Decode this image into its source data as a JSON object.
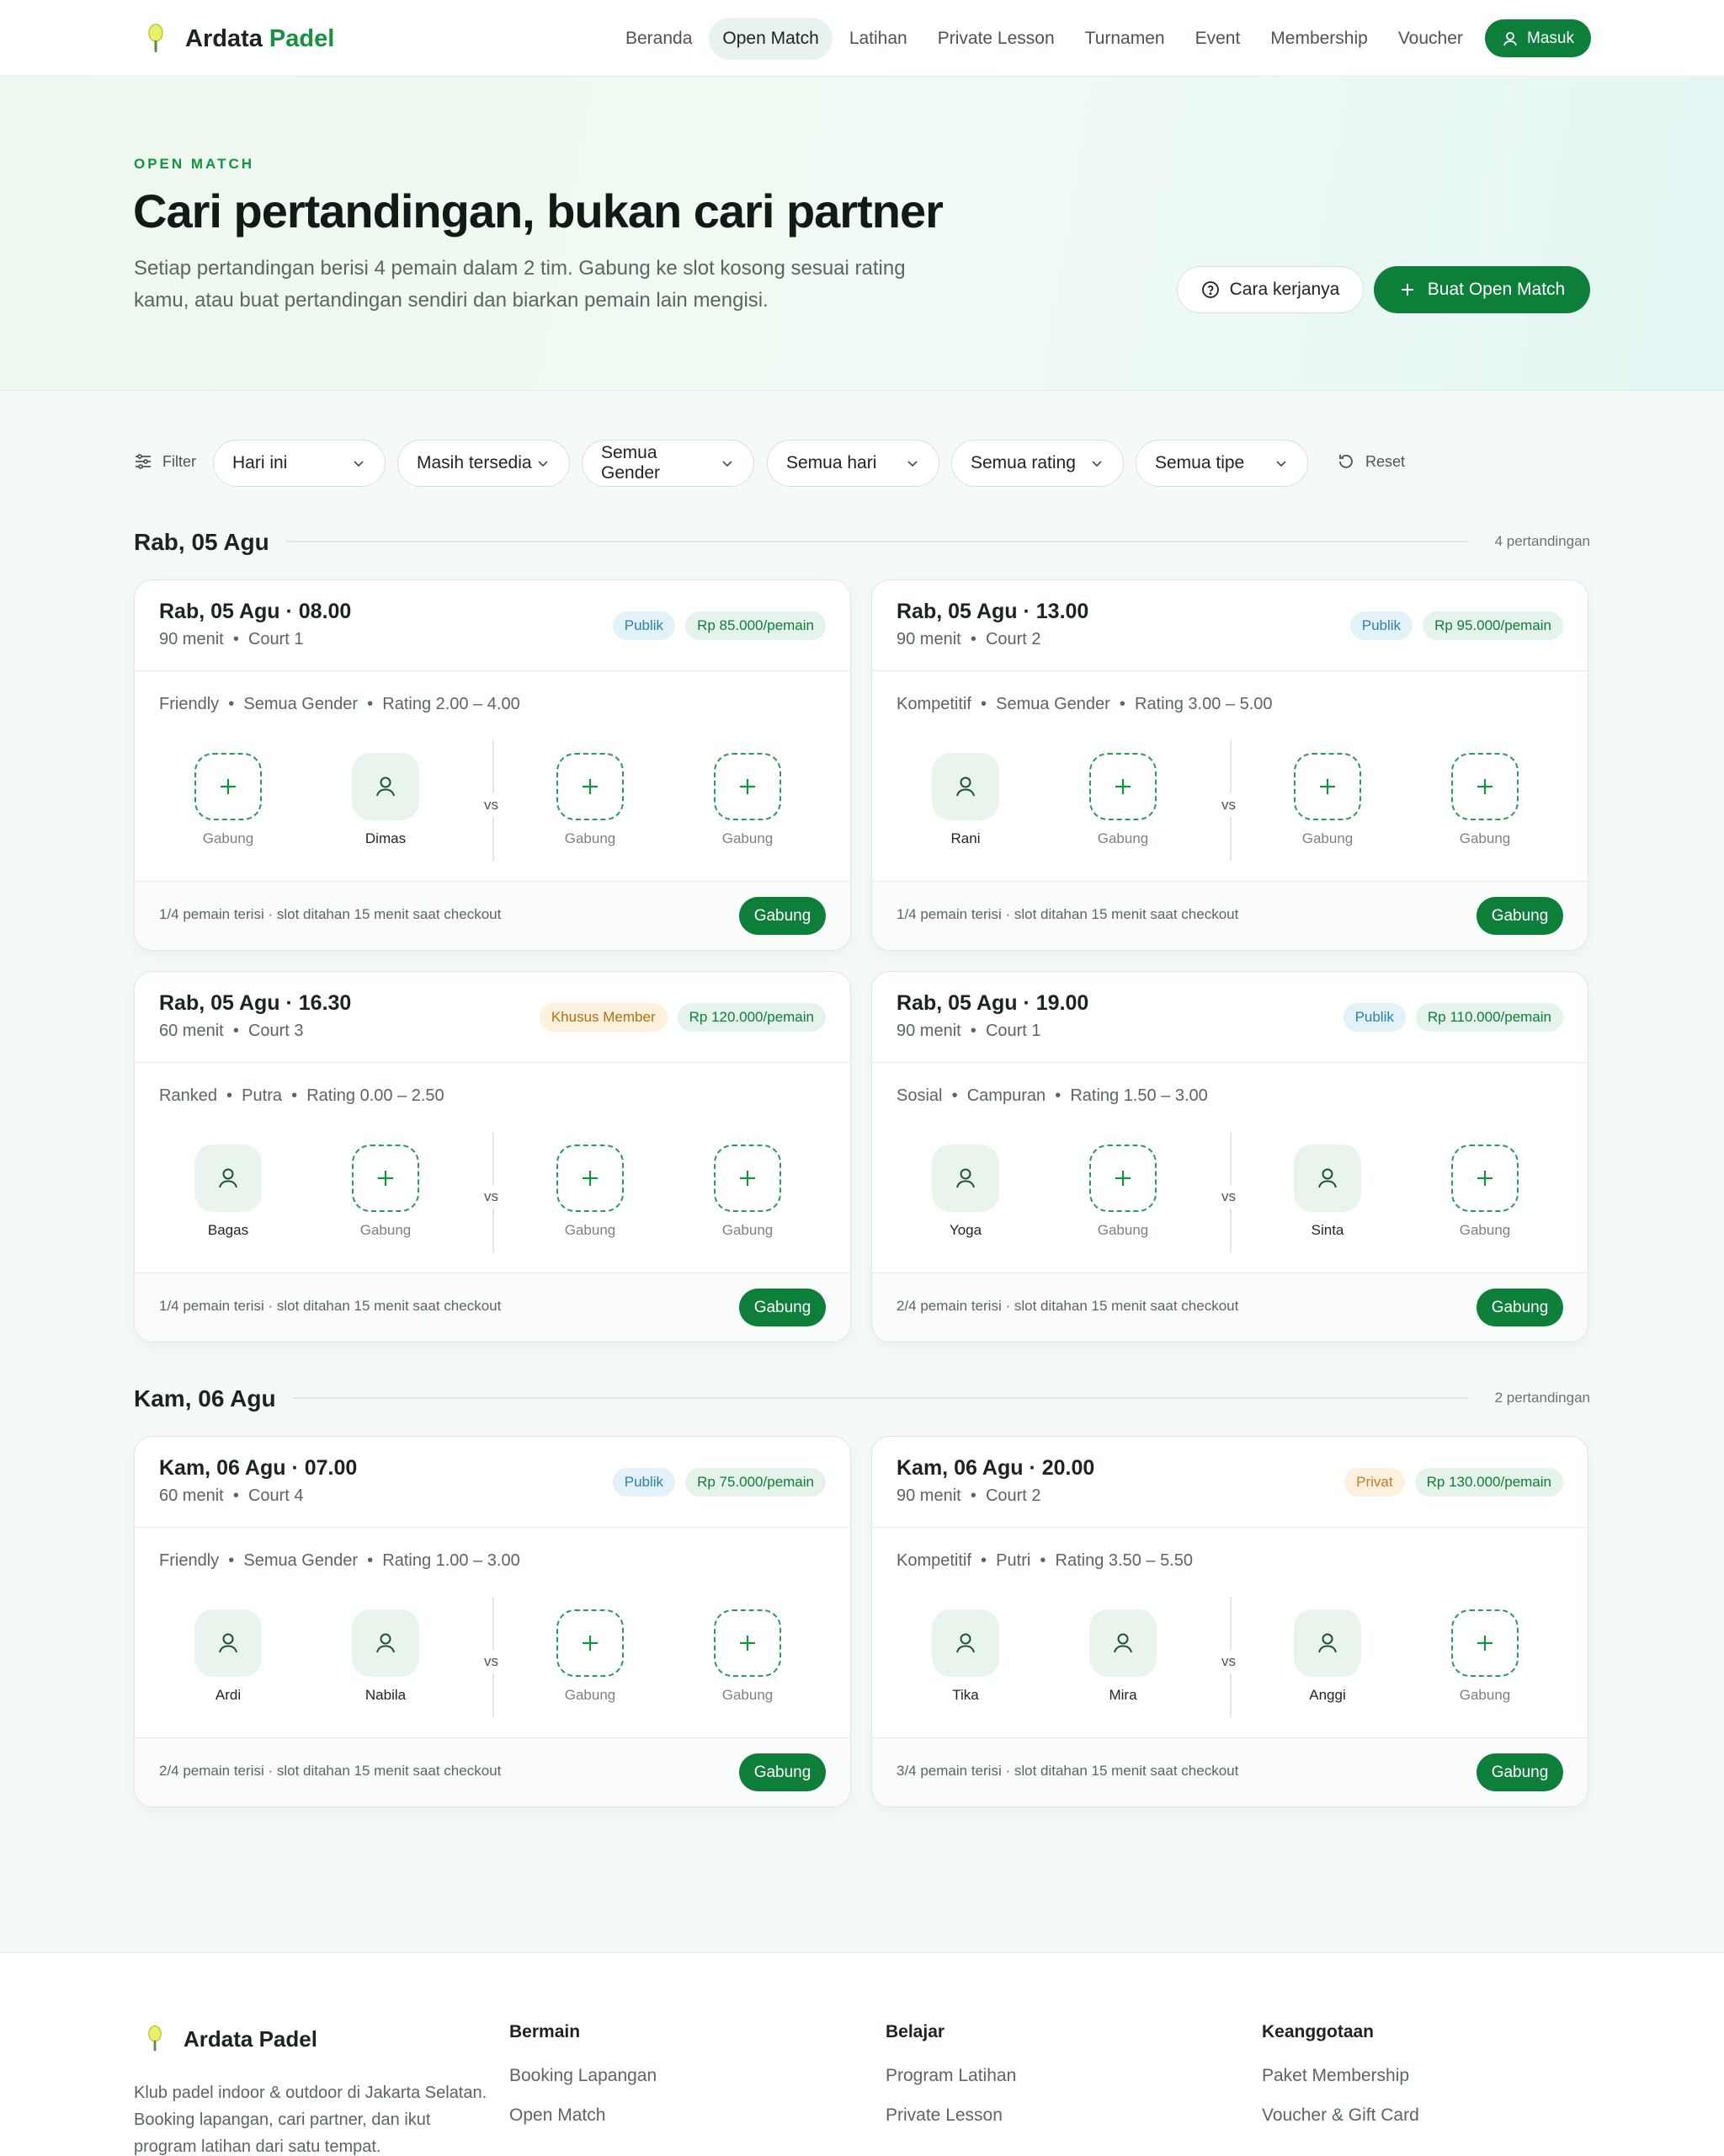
{
  "nav": {
    "brand_main": "Ardata",
    "brand_accent": "Padel",
    "links": [
      "Beranda",
      "Open Match",
      "Latihan",
      "Private Lesson",
      "Turnamen",
      "Event",
      "Membership",
      "Voucher"
    ],
    "login": "Masuk"
  },
  "hero": {
    "eyebrow": "OPEN MATCH",
    "title": "Cari pertandingan, bukan cari partner",
    "subtitle": "Setiap pertandingan berisi 4 pemain dalam 2 tim. Gabung ke slot kosong sesuai rating kamu, atau buat pertandingan sendiri dan biarkan pemain lain mengisi.",
    "how_button": "Cara kerjanya",
    "create_button": "Buat Open Match"
  },
  "filters": {
    "label": "Filter",
    "selects": [
      "Hari ini",
      "Masih tersedia",
      "Semua Gender",
      "Semua hari",
      "Semua rating",
      "Semua tipe"
    ],
    "reset": "Reset"
  },
  "days": [
    {
      "title": "Rab, 05 Agu",
      "count": "4 pertandingan",
      "matches": [
        {
          "time": "Rab, 05 Agu · 08.00",
          "duration": "90 menit",
          "court": "Court 1",
          "access": "Publik",
          "access_type": "publik",
          "price": "Rp 85.000/pemain",
          "type": "Friendly",
          "gender": "Semua Gender",
          "rating": "Rating 2.00 – 4.00",
          "slots": [
            {
              "name": "Gabung",
              "filled": false
            },
            {
              "name": "Dimas",
              "filled": true
            },
            {
              "name": "Gabung",
              "filled": false
            },
            {
              "name": "Gabung",
              "filled": false
            }
          ],
          "note": "1/4 pemain terisi · slot ditahan 15 menit saat checkout",
          "join": "Gabung"
        },
        {
          "time": "Rab, 05 Agu · 13.00",
          "duration": "90 menit",
          "court": "Court 2",
          "access": "Publik",
          "access_type": "publik",
          "price": "Rp 95.000/pemain",
          "type": "Kompetitif",
          "gender": "Semua Gender",
          "rating": "Rating 3.00 – 5.00",
          "slots": [
            {
              "name": "Rani",
              "filled": true
            },
            {
              "name": "Gabung",
              "filled": false
            },
            {
              "name": "Gabung",
              "filled": false
            },
            {
              "name": "Gabung",
              "filled": false
            }
          ],
          "note": "1/4 pemain terisi · slot ditahan 15 menit saat checkout",
          "join": "Gabung"
        },
        {
          "time": "Rab, 05 Agu · 16.30",
          "duration": "60 menit",
          "court": "Court 3",
          "access": "Khusus Member",
          "access_type": "member",
          "price": "Rp 120.000/pemain",
          "type": "Ranked",
          "gender": "Putra",
          "rating": "Rating 0.00 – 2.50",
          "slots": [
            {
              "name": "Bagas",
              "filled": true
            },
            {
              "name": "Gabung",
              "filled": false
            },
            {
              "name": "Gabung",
              "filled": false
            },
            {
              "name": "Gabung",
              "filled": false
            }
          ],
          "note": "1/4 pemain terisi · slot ditahan 15 menit saat checkout",
          "join": "Gabung"
        },
        {
          "time": "Rab, 05 Agu · 19.00",
          "duration": "90 menit",
          "court": "Court 1",
          "access": "Publik",
          "access_type": "publik",
          "price": "Rp 110.000/pemain",
          "type": "Sosial",
          "gender": "Campuran",
          "rating": "Rating 1.50 – 3.00",
          "slots": [
            {
              "name": "Yoga",
              "filled": true
            },
            {
              "name": "Gabung",
              "filled": false
            },
            {
              "name": "Sinta",
              "filled": true
            },
            {
              "name": "Gabung",
              "filled": false
            }
          ],
          "note": "2/4 pemain terisi · slot ditahan 15 menit saat checkout",
          "join": "Gabung"
        }
      ]
    },
    {
      "title": "Kam, 06 Agu",
      "count": "2 pertandingan",
      "matches": [
        {
          "time": "Kam, 06 Agu · 07.00",
          "duration": "60 menit",
          "court": "Court 4",
          "access": "Publik",
          "access_type": "publik",
          "price": "Rp 75.000/pemain",
          "type": "Friendly",
          "gender": "Semua Gender",
          "rating": "Rating 1.00 – 3.00",
          "slots": [
            {
              "name": "Ardi",
              "filled": true
            },
            {
              "name": "Nabila",
              "filled": true
            },
            {
              "name": "Gabung",
              "filled": false
            },
            {
              "name": "Gabung",
              "filled": false
            }
          ],
          "note": "2/4 pemain terisi · slot ditahan 15 menit saat checkout",
          "join": "Gabung"
        },
        {
          "time": "Kam, 06 Agu · 20.00",
          "duration": "90 menit",
          "court": "Court 2",
          "access": "Privat",
          "access_type": "privat",
          "price": "Rp 130.000/pemain",
          "type": "Kompetitif",
          "gender": "Putri",
          "rating": "Rating 3.50 – 5.50",
          "slots": [
            {
              "name": "Tika",
              "filled": true
            },
            {
              "name": "Mira",
              "filled": true
            },
            {
              "name": "Anggi",
              "filled": true
            },
            {
              "name": "Gabung",
              "filled": false
            }
          ],
          "note": "3/4 pemain terisi · slot ditahan 15 menit saat checkout",
          "join": "Gabung"
        }
      ]
    }
  ],
  "vs_label": "vs",
  "footer": {
    "brand": "Ardata Padel",
    "desc": "Klub padel indoor & outdoor di Jakarta Selatan. Booking lapangan, cari partner, dan ikut program latihan dari satu tempat.",
    "columns": [
      {
        "title": "Bermain",
        "links": [
          "Booking Lapangan",
          "Open Match"
        ]
      },
      {
        "title": "Belajar",
        "links": [
          "Program Latihan",
          "Private Lesson"
        ]
      },
      {
        "title": "Keanggotaan",
        "links": [
          "Paket Membership",
          "Voucher & Gift Card"
        ]
      }
    ]
  },
  "colors": {
    "primary": "#0e7f3b",
    "accent": "#14933f",
    "publik": "#2e7fa8",
    "member": "#b86d15"
  }
}
